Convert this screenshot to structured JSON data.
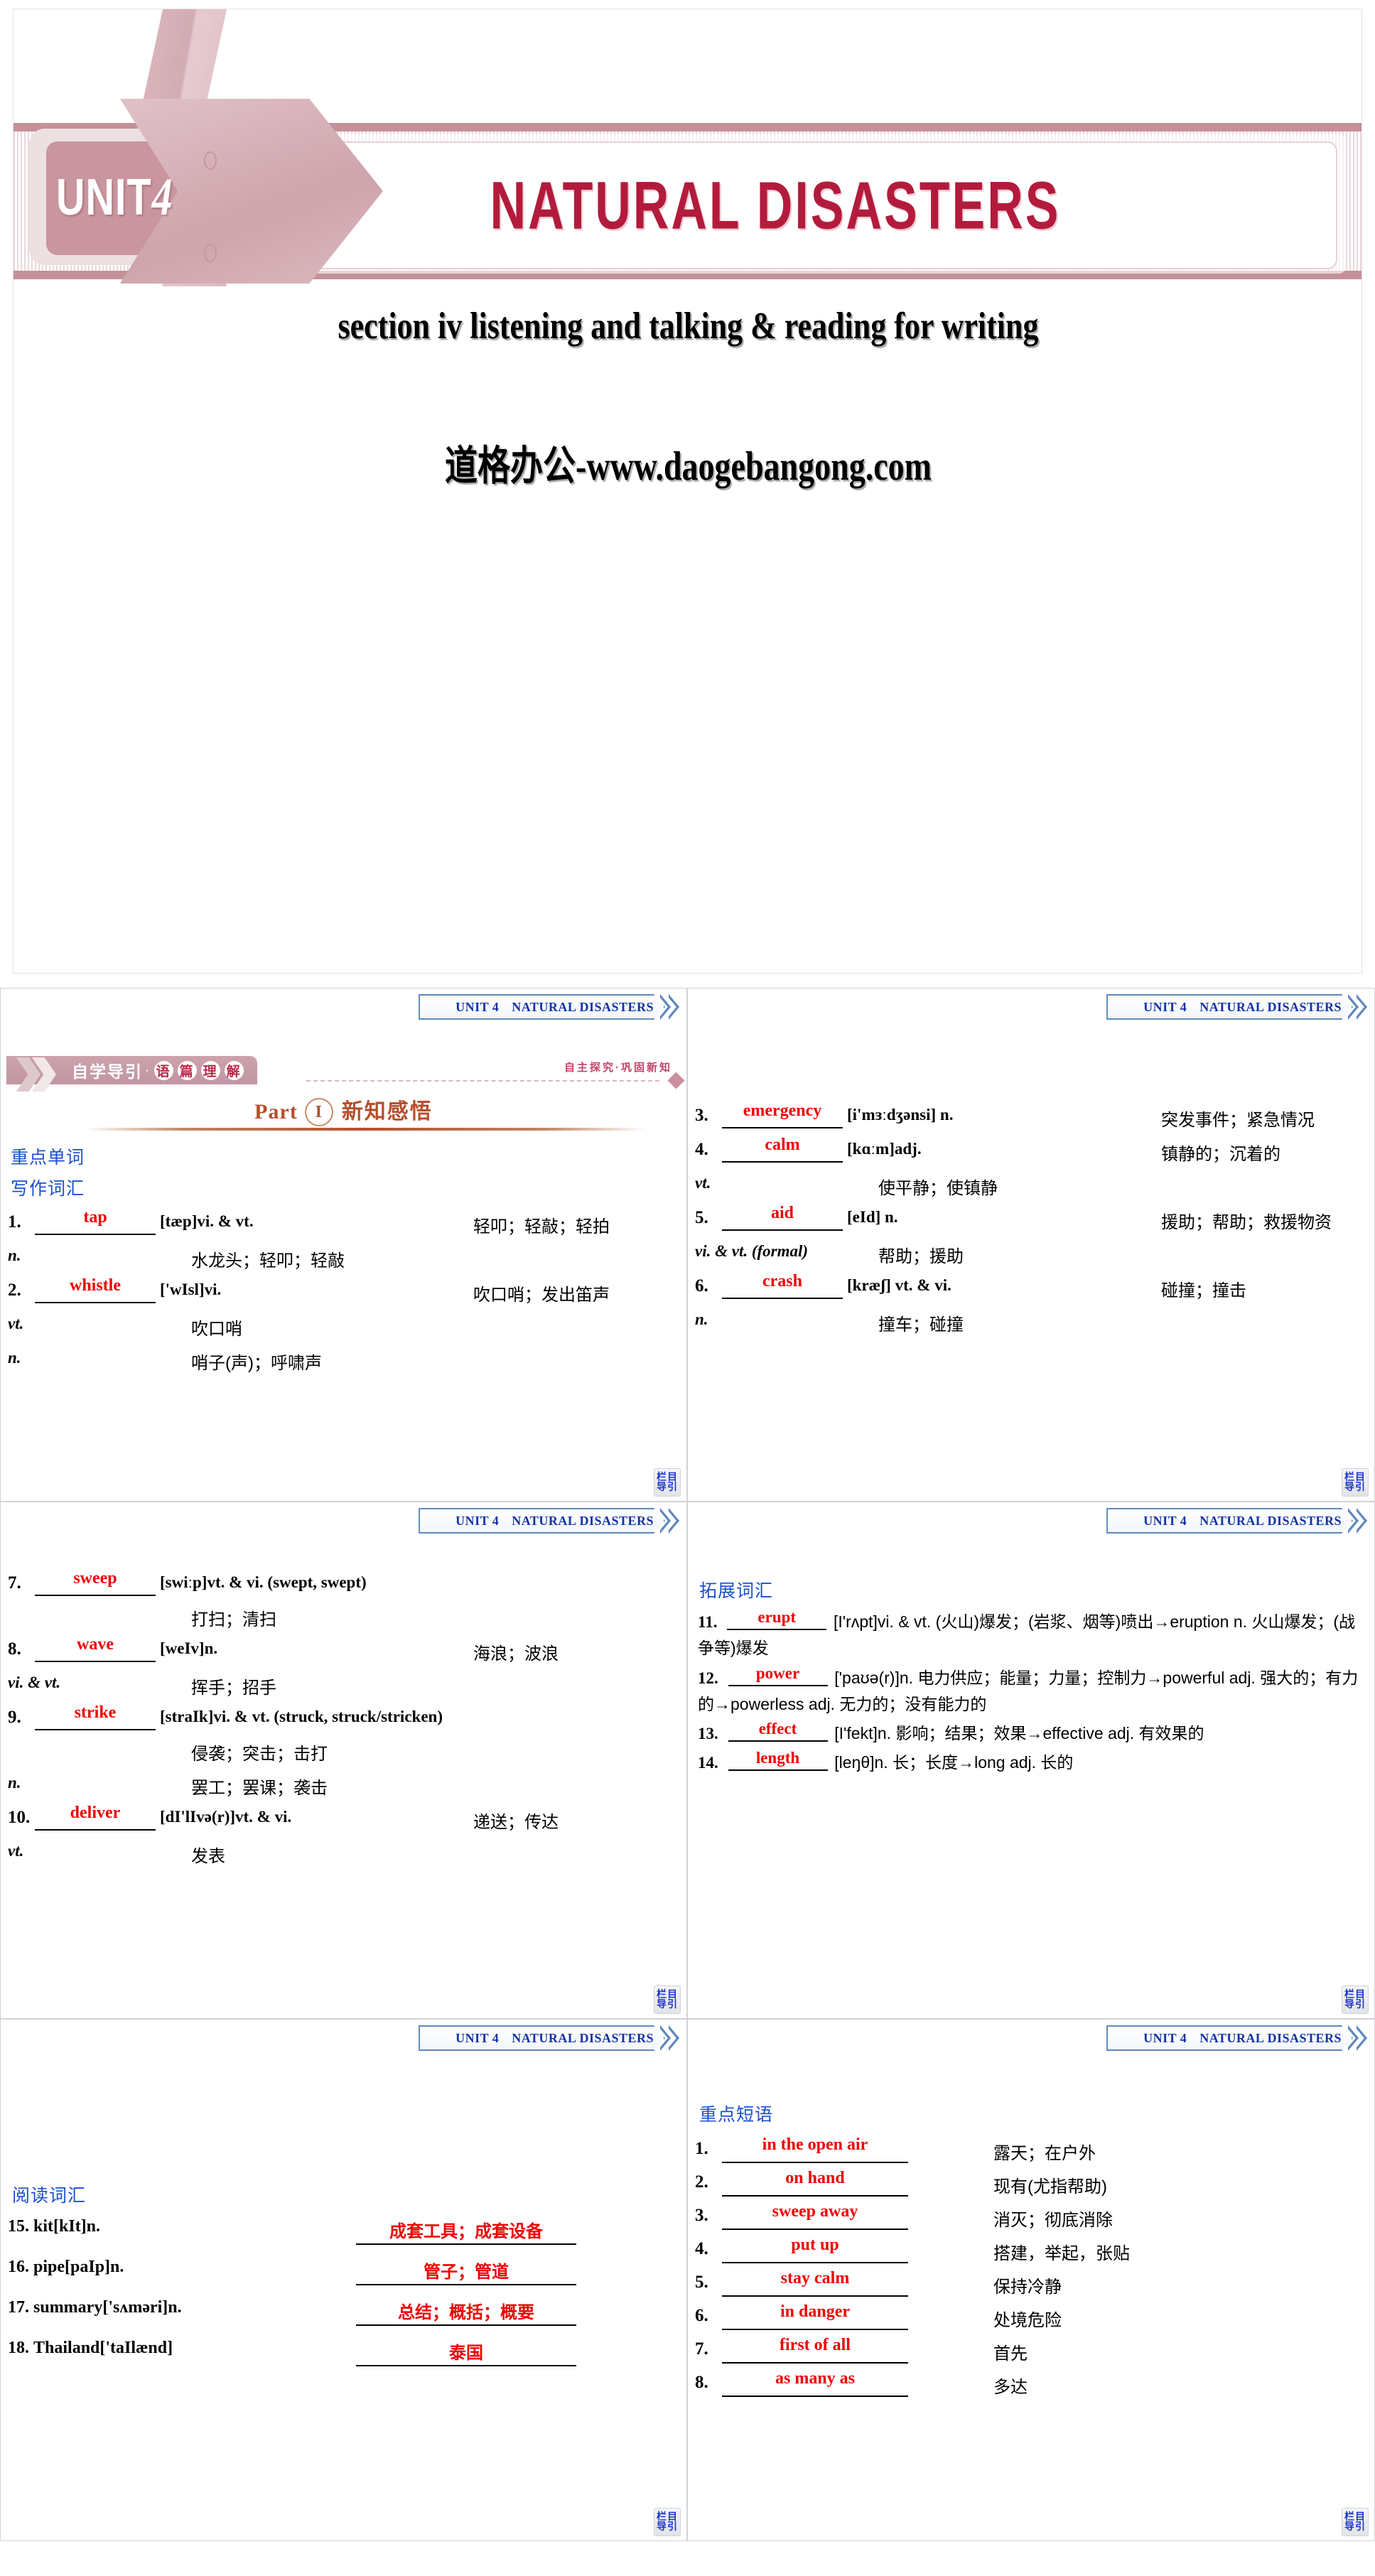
{
  "cover": {
    "unit_label": "UNIT",
    "unit_number": "4",
    "title": "NATURAL DISASTERS",
    "subtitle": "section iv listening and talking & reading for writing",
    "brand": "道格办公-www.daogebangong.com",
    "accent_color": "#b31b3c",
    "band_color": "#c59098"
  },
  "ribbon": {
    "unit": "UNIT 4",
    "title": "NATURAL DISASTERS"
  },
  "nav_button": {
    "line1": "栏目",
    "line2": "导引"
  },
  "panel1": {
    "tag_plain": "自学导引",
    "tag_dot": "·",
    "tag_circled": [
      "语",
      "篇",
      "理",
      "解"
    ],
    "tag_right": "自主探究·巩固新知",
    "part_label": "Part",
    "part_number": "I",
    "part_cn": "新知感悟",
    "heading_keywords": "重点单词",
    "heading_writing": "写作词汇",
    "entries": [
      {
        "num": "1.",
        "answer": "tap",
        "mid": "[tæp]vi. & vt.",
        "cn": "轻叩；轻敲；轻拍",
        "subs": [
          {
            "pos": "n.",
            "cn": "水龙头；轻叩；轻敲"
          }
        ]
      },
      {
        "num": "2.",
        "answer": "whistle",
        "mid": "['wIsl]vi.",
        "cn": "吹口哨；发出笛声",
        "subs": [
          {
            "pos": "vt.",
            "cn": "吹口哨"
          },
          {
            "pos": "n.",
            "cn": "哨子(声)；呼啸声"
          }
        ]
      }
    ]
  },
  "panel2": {
    "entries": [
      {
        "num": "3.",
        "answer": "emergency",
        "mid": "[i'mɜːdʒənsi] n.",
        "cn": "突发事件；紧急情况",
        "subs": []
      },
      {
        "num": "4.",
        "answer": "calm",
        "mid": "[kɑːm]adj.",
        "cn": "镇静的；沉着的",
        "subs": [
          {
            "pos": "vt.",
            "cn": "使平静；使镇静"
          }
        ]
      },
      {
        "num": "5.",
        "answer": "aid",
        "mid": "[eId] n.",
        "cn": "援助；帮助；救援物资",
        "subs": [
          {
            "pos": "vi. & vt. (formal)",
            "cn": "帮助；援助"
          }
        ]
      },
      {
        "num": "6.",
        "answer": "crash",
        "mid": "[kræʃ] vt. & vi.",
        "cn": "碰撞；撞击",
        "subs": [
          {
            "pos": "n.",
            "cn": "撞车；碰撞"
          }
        ]
      }
    ]
  },
  "panel3": {
    "entries": [
      {
        "num": "7.",
        "answer": "sweep",
        "mid": "[swiːp]vt. & vi. (swept, swept)",
        "cn": "",
        "subs": [
          {
            "pos": "",
            "cn": "打扫；清扫"
          }
        ]
      },
      {
        "num": "8.",
        "answer": "wave",
        "mid": "[weIv]n.",
        "cn": "海浪；波浪",
        "subs": [
          {
            "pos": "vi. & vt.",
            "cn": "挥手；招手"
          }
        ]
      },
      {
        "num": "9.",
        "answer": "strike",
        "mid": "[straIk]vi. & vt. (struck, struck/stricken)",
        "cn": "",
        "subs": [
          {
            "pos": "",
            "cn": "侵袭；突击；击打"
          },
          {
            "pos": "n.",
            "cn": "罢工；罢课；袭击"
          }
        ]
      },
      {
        "num": "10.",
        "answer": "deliver",
        "mid": "[dI'lIvə(r)]vt. & vi.",
        "cn": "递送；传达",
        "subs": [
          {
            "pos": "vt.",
            "cn": "发表"
          }
        ]
      }
    ]
  },
  "panel4": {
    "heading": "拓展词汇",
    "entries": [
      {
        "num": "11.",
        "answer": "erupt",
        "rest": "[I'rʌpt]vi. & vt. (火山)爆发；(岩浆、烟等)喷出→eruption n. 火山爆发；(战争等)爆发"
      },
      {
        "num": "12.",
        "answer": "power",
        "rest": "['paʊə(r)]n. 电力供应；能量；力量；控制力→powerful adj. 强大的；有力的→powerless adj. 无力的；没有能力的"
      },
      {
        "num": "13.",
        "answer": "effect",
        "rest": "[I'fekt]n. 影响；结果；效果→effective adj. 有效果的"
      },
      {
        "num": "14.",
        "answer": "length",
        "rest": "[leŋθ]n. 长；长度→long adj. 长的"
      }
    ]
  },
  "panel5": {
    "heading": "阅读词汇",
    "entries": [
      {
        "num": "15.",
        "left": "kit[kIt]n.",
        "right": "成套工具；成套设备"
      },
      {
        "num": "16.",
        "left": "pipe[paIp]n.",
        "right": "管子；管道"
      },
      {
        "num": "17.",
        "left": "summary['sʌməri]n.",
        "right": "总结；概括；概要"
      },
      {
        "num": "18.",
        "left": "Thailand['taIlænd]",
        "right": "泰国"
      }
    ]
  },
  "panel6": {
    "heading": "重点短语",
    "entries": [
      {
        "num": "1.",
        "answer": "in the open air",
        "cn": "露天；在户外"
      },
      {
        "num": "2.",
        "answer": "on hand",
        "cn": "现有(尤指帮助)"
      },
      {
        "num": "3.",
        "answer": "sweep away",
        "cn": "消灭；彻底消除"
      },
      {
        "num": "4.",
        "answer": "put up",
        "cn": "搭建，举起，张贴"
      },
      {
        "num": "5.",
        "answer": "stay calm",
        "cn": "保持冷静"
      },
      {
        "num": "6.",
        "answer": "in danger",
        "cn": "处境危险"
      },
      {
        "num": "7.",
        "answer": "first of all",
        "cn": "首先"
      },
      {
        "num": "8.",
        "answer": "as many as",
        "cn": "多达"
      }
    ]
  }
}
